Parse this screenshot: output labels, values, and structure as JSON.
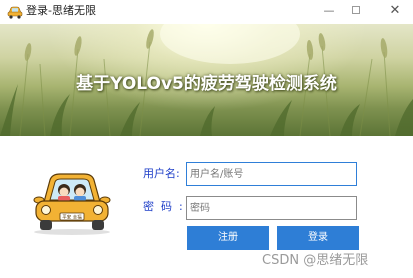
{
  "window": {
    "title": "登录-思绪无限",
    "app_icon": "car-icon",
    "controls": {
      "minimize": "—",
      "close": "✕"
    }
  },
  "banner": {
    "title": "基于YOLOv5的疲劳驾驶检测系统",
    "background": "wheat-field"
  },
  "form": {
    "username_label": "用户名:",
    "username_placeholder": "用户名/账号",
    "username_value": "",
    "password_label": "密码:",
    "password_placeholder": "密码",
    "password_value": "",
    "register_label": "注册",
    "login_label": "登录"
  },
  "illustration": {
    "icon": "car-with-passengers-icon",
    "plate": "平安 幸福"
  },
  "watermark": "CSDN @思绪无限",
  "colors": {
    "accent": "#2e7ed6",
    "label": "#1f3fc8",
    "car_body": "#f2b234"
  }
}
